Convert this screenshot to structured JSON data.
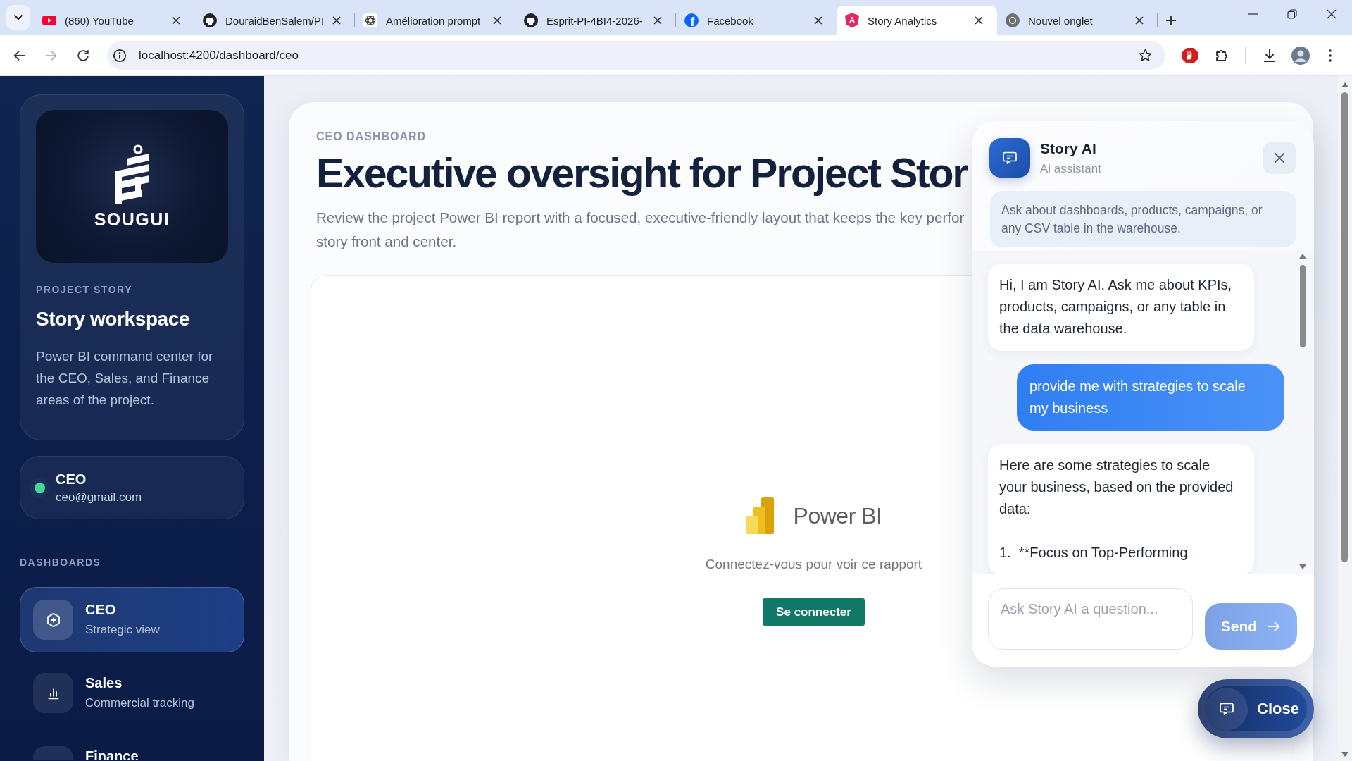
{
  "browser": {
    "tabs": [
      {
        "title": "(860) YouTube",
        "kind": "video",
        "selected": false
      },
      {
        "title": "DouraidBenSalem/PI",
        "kind": "repo",
        "selected": false
      },
      {
        "title": "Amélioration prompt",
        "kind": "chat",
        "selected": false
      },
      {
        "title": "Esprit-PI-4BI4-2026-",
        "kind": "repo",
        "selected": false
      },
      {
        "title": "Facebook",
        "kind": "social",
        "logo_letter": "f",
        "selected": false
      },
      {
        "title": "Story Analytics",
        "kind": "app",
        "logo_letter": "A",
        "selected": true
      },
      {
        "title": "Nouvel onglet",
        "kind": "newtab",
        "selected": false
      }
    ],
    "address": "localhost:4200/dashboard/ceo"
  },
  "sidebar": {
    "brand": {
      "logo_text": "SOUGUI",
      "eyebrow": "PROJECT STORY",
      "title": "Story workspace",
      "description": "Power BI command center for the CEO, Sales, and Finance areas of the project."
    },
    "user": {
      "name": "CEO",
      "email": "ceo@gmail.com",
      "online": true
    },
    "section_label": "DASHBOARDS",
    "nav": [
      {
        "title": "CEO",
        "subtitle": "Strategic view",
        "kind": "strategy",
        "selected": true
      },
      {
        "title": "Sales",
        "subtitle": "Commercial tracking",
        "kind": "chart",
        "selected": false
      },
      {
        "title": "Finance",
        "kind": "finance",
        "selected": false
      }
    ]
  },
  "main": {
    "eyebrow": "CEO DASHBOARD",
    "title": "Executive oversight for Project Stor",
    "description_lines": [
      "Review the project Power BI report with a focused, executive-friendly layout that keeps the key perfor",
      "story front and center."
    ],
    "report": {
      "product": "Power BI",
      "message": "Connectez-vous pour voir ce rapport",
      "button": "Se connecter"
    }
  },
  "chat": {
    "title": "Story AI",
    "subtitle": "Ai assistant",
    "hint": "Ask about dashboards, products, campaigns, or any CSV table in the warehouse.",
    "messages": [
      {
        "kind": "assistant",
        "text": "Hi, I am Story AI. Ask me about KPIs, products, campaigns, or any table in the data warehouse."
      },
      {
        "kind": "user",
        "text": "provide me with strategies to scale my business"
      },
      {
        "kind": "assistant",
        "text": "Here are some strategies to scale your business, based on the provided data:\n\n1.  **Focus on Top-Performing"
      }
    ],
    "input": {
      "placeholder": "Ask Story AI a question..."
    },
    "send": {
      "label": "Send",
      "disabled": true
    }
  },
  "chat_toggle": {
    "label": "Close"
  }
}
